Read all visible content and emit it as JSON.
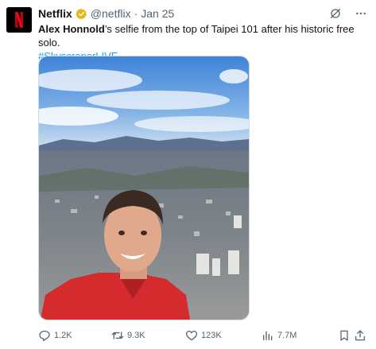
{
  "account": {
    "name": "Netflix",
    "handle": "@netflix",
    "separator": "·",
    "date": "Jan 25"
  },
  "tweet": {
    "name_bold": "Alex Honnold",
    "text_rest": "’s selfie from the top of Taipei 101 after his historic free solo.",
    "hashtag": "#SkyscraperLIVE"
  },
  "actions": {
    "replies": "1.2K",
    "reposts": "9.3K",
    "likes": "123K",
    "views": "7.7M"
  },
  "colors": {
    "accent": "#1d9bf0",
    "verified": "#e2b719",
    "brand": "#e50914"
  },
  "icons": {
    "more": "more-icon",
    "grok": "grok-icon",
    "reply": "reply-icon",
    "repost": "repost-icon",
    "like": "like-icon",
    "views": "views-icon",
    "bookmark": "bookmark-icon",
    "share": "share-icon"
  }
}
